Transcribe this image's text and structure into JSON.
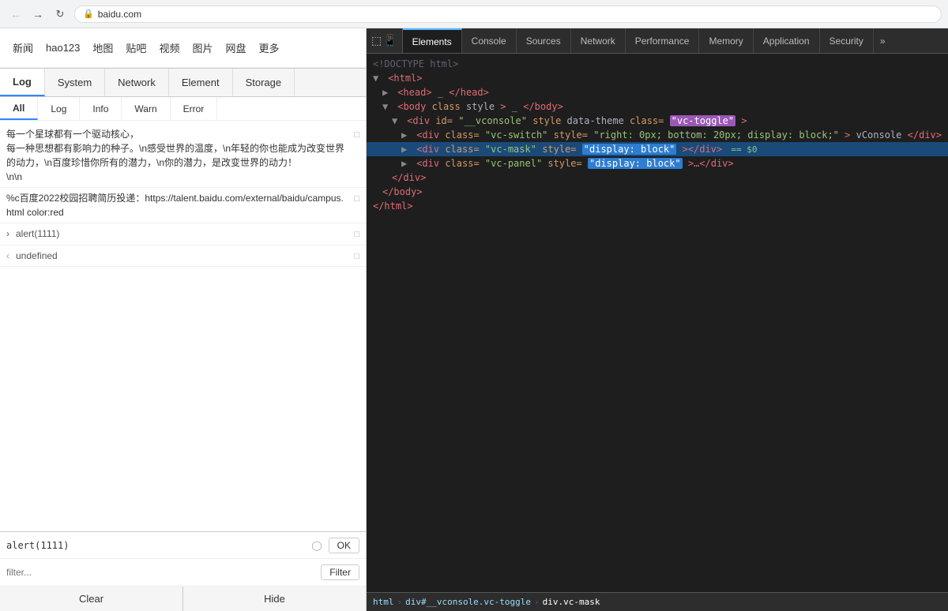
{
  "browser": {
    "back_btn": "←",
    "forward_btn": "→",
    "refresh_btn": "↻",
    "url": "baidu.com",
    "lock_icon": "🔒"
  },
  "baidu_nav": {
    "items": [
      "新闻",
      "hao123",
      "地图",
      "贴吧",
      "视频",
      "图片",
      "网盘",
      "更多"
    ]
  },
  "vconsole": {
    "tabs": [
      {
        "label": "Log",
        "active": true
      },
      {
        "label": "System",
        "active": false
      },
      {
        "label": "Network",
        "active": false
      },
      {
        "label": "Element",
        "active": false
      },
      {
        "label": "Storage",
        "active": false
      }
    ],
    "filter_items": [
      {
        "label": "All",
        "active": true
      },
      {
        "label": "Log",
        "active": false
      },
      {
        "label": "Info",
        "active": false
      },
      {
        "label": "Warn",
        "active": false
      },
      {
        "label": "Error",
        "active": false
      }
    ],
    "console_entries": [
      {
        "type": "log",
        "text": "每一个星球都有一个驱动核心，\n每一种思想都有影响力的种子。\\n感受世界的温度，\\n年轻的你也能成为改变世界的动力，\\n百度珍惜你所有的潜力，\\n你的潜力，是改变世界的动力！\n\\n\\n",
        "has_copy": true
      },
      {
        "type": "log",
        "text": "%c百度2022校园招聘简历投递：https://talent.baidu.com/external/baidu/campus.html color:red",
        "has_copy": true
      },
      {
        "type": "alert",
        "prefix": "›",
        "text": "alert(1111)",
        "has_copy": true
      },
      {
        "type": "result",
        "prefix": "‹",
        "text": "undefined",
        "has_copy": true
      }
    ],
    "input_value": "alert(1111)",
    "input_placeholder": "",
    "filter_placeholder": "filter...",
    "ok_label": "OK",
    "filter_label": "Filter",
    "clear_label": "Clear",
    "hide_label": "Hide"
  },
  "devtools": {
    "tabs": [
      "Elements",
      "Console",
      "Sources",
      "Network",
      "Performance",
      "Memory",
      "Application",
      "Security"
    ],
    "active_tab": "Elements",
    "controls": [
      "⋮⋮",
      "✕"
    ],
    "dom_lines": [
      {
        "indent": 0,
        "content": "<!DOCTYPE html>",
        "type": "comment"
      },
      {
        "indent": 0,
        "content": "<html>",
        "type": "tag",
        "collapsed": false
      },
      {
        "indent": 1,
        "content": "<head>_</head>",
        "type": "tag"
      },
      {
        "indent": 1,
        "content": "<body class style>_</body>",
        "type": "tag",
        "collapsed": false
      },
      {
        "indent": 2,
        "content": "<div id=\"__vconsole\" style data-theme class=\"vc-toggle\">",
        "type": "tag",
        "has_highlight": true,
        "highlight_text": "vc-toggle"
      },
      {
        "indent": 3,
        "content": "<div class=\"vc-switch\" style=\"right: 0px; bottom: 20px; display: block;\">vConsole</div>",
        "type": "tag"
      },
      {
        "indent": 3,
        "content": "<div class=\"vc-mask\" style=\"display: block\"></div>",
        "type": "tag",
        "selected": true,
        "has_highlight": true,
        "highlight_text": "display: block"
      },
      {
        "indent": 3,
        "content": "<div class=\"vc-panel\" style=\"display: block\">…</div>",
        "type": "tag",
        "has_highlight": true,
        "highlight_text": "display: block"
      },
      {
        "indent": 2,
        "content": "</div>",
        "type": "tag"
      },
      {
        "indent": 1,
        "content": "</body>",
        "type": "tag"
      },
      {
        "indent": 0,
        "content": "</html>",
        "type": "tag"
      }
    ],
    "breadcrumb": [
      {
        "label": "html"
      },
      {
        "label": "div#__vconsole.vc-toggle"
      },
      {
        "label": "div.vc-mask"
      }
    ],
    "selected_element": "div.vc-mask",
    "dollar_zero": "== $0"
  }
}
